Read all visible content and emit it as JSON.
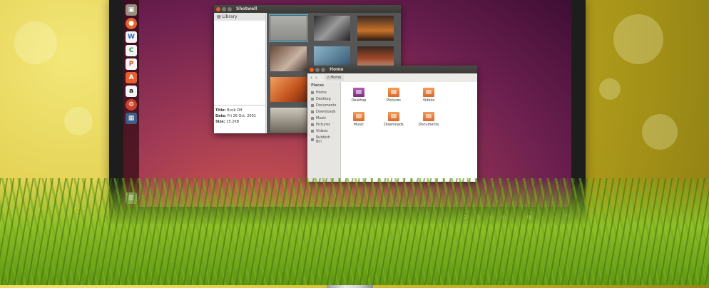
{
  "shotwell": {
    "title": "Shotwell",
    "library_label": "Library",
    "meta": [
      {
        "key": "Title:",
        "value": "Buck Off"
      },
      {
        "key": "Date:",
        "value": "Fri 26 Oct, 2001"
      },
      {
        "key": "Size:",
        "value": "15.2KB"
      }
    ]
  },
  "nautilus": {
    "title": "Home",
    "breadcrumb": "Home",
    "places_header": "Places",
    "places": [
      "Home",
      "Desktop",
      "Documents",
      "Downloads",
      "Music",
      "Pictures",
      "Videos",
      "Rubbish Bin"
    ],
    "folders": [
      {
        "label": "Desktop",
        "color": "#9b3f9d"
      },
      {
        "label": "Pictures",
        "color": "#e07a35"
      },
      {
        "label": "Videos",
        "color": "#e07a35"
      },
      {
        "label": "Music",
        "color": "#e07a35"
      },
      {
        "label": "Downloads",
        "color": "#e07a35"
      },
      {
        "label": "Documents",
        "color": "#e07a35"
      }
    ]
  },
  "launcher": {
    "icons": [
      "files-icon",
      "firefox-icon",
      "writer-icon",
      "calc-icon",
      "impress-icon",
      "software-center-icon",
      "amazon-icon",
      "settings-icon",
      "workspaces-icon",
      "trash-icon"
    ]
  },
  "colors": {
    "ubuntu_orange": "#f15d22",
    "wallpaper_dark": "#3e0e33",
    "wallpaper_light": "#d4584a"
  }
}
